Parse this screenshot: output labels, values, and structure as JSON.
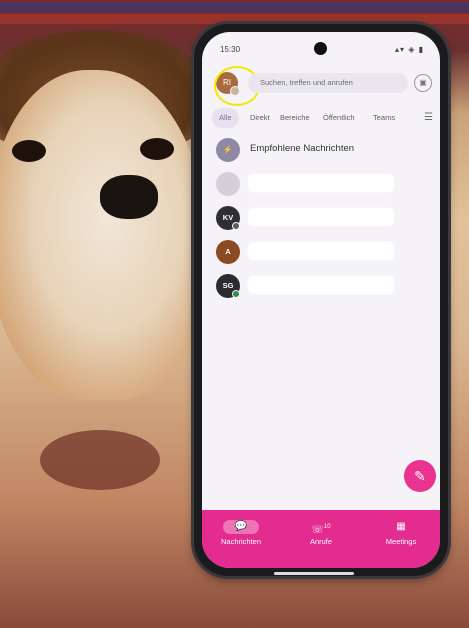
{
  "status_bar": {
    "time": "15:30",
    "icons": "▴▾ ◈ ▮"
  },
  "header": {
    "avatar_initials": "RI",
    "search_placeholder": "Suchen, treffen und anrufen",
    "meet_icon": "camera-icon"
  },
  "tabs": [
    {
      "label": "Alle",
      "active": true
    },
    {
      "label": "Direkt"
    },
    {
      "label": "Bereiche"
    },
    {
      "label": "Öffentlich"
    },
    {
      "label": "Teams"
    }
  ],
  "chats": [
    {
      "initials": "⚡",
      "label": "Empfohlene Nachrichten",
      "color": "#8e8aa3",
      "redacted": false
    },
    {
      "initials": "",
      "label": "",
      "color": "#d3d0da",
      "redacted": true
    },
    {
      "initials": "KV",
      "label": "",
      "color": "#2f2f33",
      "redacted": true,
      "status_color": "#5a5a5f"
    },
    {
      "initials": "A",
      "label": "",
      "color": "#8a4a22",
      "redacted": true
    },
    {
      "initials": "SG",
      "label": "",
      "color": "#2b2b30",
      "redacted": true,
      "status_color": "#2f8f4e"
    }
  ],
  "bottom_nav": [
    {
      "label": "Nachrichten",
      "icon": "chat-icon",
      "active": true
    },
    {
      "label": "Anrufe",
      "icon": "phone-icon",
      "badge": "10"
    },
    {
      "label": "Meetings",
      "icon": "calendar-icon"
    }
  ],
  "colors": {
    "accent": "#e42b8f",
    "highlight": "#f3e800"
  }
}
